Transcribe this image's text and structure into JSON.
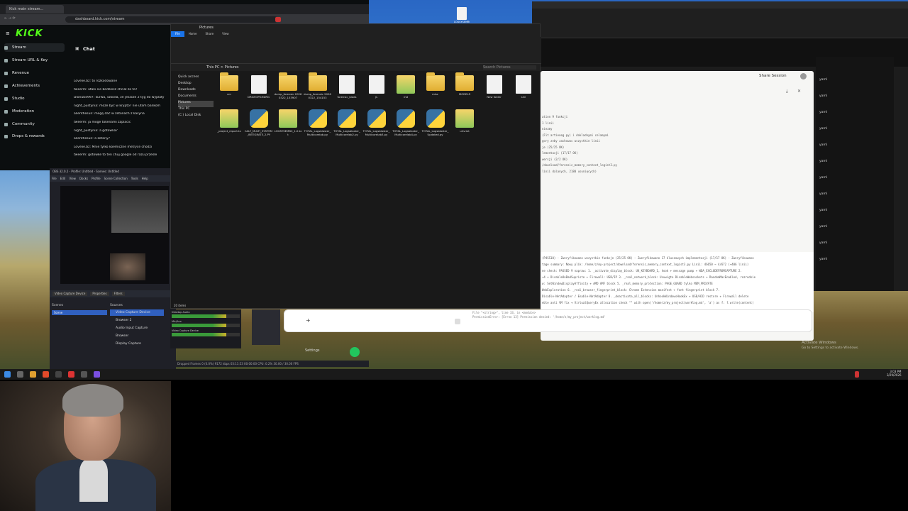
{
  "kick": {
    "tab_title": "Kick main stream...",
    "url": "dashboard.kick.com/stream",
    "logo": "KICK",
    "nav": [
      "Stream",
      "Stream URL & Key",
      "Revenue",
      "Achievements",
      "Studio",
      "Moderation",
      "Community",
      "Drops & rewards"
    ],
    "chat_title": "Chat",
    "messages": [
      "Lovelie.bz: to rozkodowane",
      "tweerm: ataki sie bedziesz chcial za to?",
      "Dionizos997: kurwa, szkoda, ze jeszcze 2 tyg do wyplaty",
      "night_pustynia: może być w krypto? nie ufam bankom",
      "alienthesun: mogę dać w żetonach z kasyna",
      "tweerm: ja moge tokenami zaplacic",
      "night_pustynia: a gotowka?",
      "alienthesun: a żetony?",
      "Lovelie.bz: Mnie tylko koemiczne metryce chodzi",
      "tweerm: gotowke to ten chuj google od razu przesle"
    ]
  },
  "obs": {
    "title": "OBS 32.0.2 - Profile: Untitled - Scenes: Untitled",
    "menu": [
      "File",
      "Edit",
      "View",
      "Docks",
      "Profile",
      "Scene Collection",
      "Tools",
      "Help"
    ],
    "toolbar": [
      "Video Capture Device",
      "Properties",
      "Filters"
    ],
    "scenes_title": "Scenes",
    "scene_selected": "Scene",
    "sources_title": "Sources",
    "sources": [
      "Video Capture Device",
      "Browser 2",
      "Audio Input Capture",
      "Browser",
      "Display Capture"
    ],
    "mixer": [
      "Desktop Audio",
      "Mic/Aux",
      "Video Capture Device"
    ],
    "settings_label": "Settings",
    "status": "Dropped Frames 0 (0.0%)    9172 kbps    03:11:53    00:00:00    CPU: 0.2%    30.00 / 30.00 FPS"
  },
  "explorer": {
    "title": "Pictures",
    "ribbon_tabs": [
      "File",
      "Home",
      "Share",
      "View"
    ],
    "path": "This PC > Pictures",
    "search_placeholder": "Search Pictures",
    "tree": [
      "Quick access",
      "Desktop",
      "Downloads",
      "Documents",
      "Pictures",
      "This PC",
      "(C:) Local Disk"
    ],
    "files_row1": [
      {
        "name": "cm",
        "kind": "folder"
      },
      {
        "name": "DRGHOPGHDRG",
        "kind": "doc"
      },
      {
        "name": "dump_forensic 20260322_153907",
        "kind": "folder"
      },
      {
        "name": "dump_forensic 20260322_154153",
        "kind": "folder"
      },
      {
        "name": "forensic_blads",
        "kind": "doc"
      },
      {
        "name": "js",
        "kind": "doc"
      },
      {
        "name": "md",
        "kind": "zip"
      },
      {
        "name": "misc",
        "kind": "folder"
      },
      {
        "name": "MODELS",
        "kind": "folder"
      },
      {
        "name": "New folder",
        "kind": "doc"
      },
      {
        "name": "sml",
        "kind": "doc"
      }
    ],
    "files_row2": [
      {
        "name": "_project_report.tx",
        "kind": "zip"
      },
      {
        "name": "CALY_MULTI_SYSTEM_INTEGRATE_2.PY",
        "kind": "py"
      },
      {
        "name": "LOGSYSEMBC_1.0.txt",
        "kind": "zip"
      },
      {
        "name": "TOTAL_Logsblaster_Multicorelab.py",
        "kind": "py"
      },
      {
        "name": "TOTAL_Logsblaster_Multicorelab2.py",
        "kind": "py"
      },
      {
        "name": "TOTAL_Logsblaster_Multicorelab3.py",
        "kind": "py"
      },
      {
        "name": "TOTAL_Logsblaster_Multicorelab4.py",
        "kind": "py"
      },
      {
        "name": "TOTAL_Logsblaster_Updated.py",
        "kind": "py"
      },
      {
        "name": "urls.txt",
        "kind": "zip"
      }
    ],
    "status": "20 items"
  },
  "session": {
    "share_label": "Share Session",
    "lines": [
      "ation   9 funkcji",
      "1 linii",
      "niezmy",
      "(Fit artieneg.py) i dokladnymi celamymi",
      "gory zeby zachowac wszystkie linii",
      "je (25/25 OK)",
      "lementacji (17/17 OK)",
      "wersji (2/2 OK)",
      "/download/forensic_memory_context_logist3.py",
      "linii dalanych, 2180 usunięcych)"
    ],
    "code_lines": [
      "(P4SS10) - Zweryfikowano wszystkie funkcje (25/25 OK) - Zweryfikowano 17 kluczowych implementacji (17/17 OK) - Zweryfikowano",
      "tage summary:    Nowy plik: /home/z/my-project/download/forensic_memory_context_logist3.py   Linii: 46650  → 4/672 (+406 linii)",
      "ne check: PASSED   9 napraw: 1. _activate_display_block: UK_KEYBOARD_1, hook + message pump + WDA_EXCLUDEFROMCAPTURE 2.",
      "+4 + DisableOnBadSupriste + Firewall: USB/IP 3. _real_network_block: Usuwigte DisableWebsockets + RandomMacEnabled, rozrodnie",
      "w: SetWindowDisplayAffinity + AMD AMF block 5. _real_memory_protection: PAGE_GUARD tylko MEM_PRIVATE",
      "WebExploration 6. _real_browser_fingerprint_block: Chrome Extension manifest + font fingerprint block 7.",
      "Disable-NetAdapter / Enable-NetAdapter 8. _deactivate_all_blocks: UnhookWindowsHookEx + USB/HID restore + Firewall delete",
      "eble anti VM fix + VirtualQueryEx allocation check   \"\" with open('/home/z/my_project/worklog.md', 'a') as f: f.write(content)"
    ],
    "error_lines": [
      "File \"<string>\", line 33, in <module>",
      "PermissionError: [Errno 13] Permission denied: '/home/z/my_project/worklog.md'"
    ],
    "input_plus": "+"
  },
  "right_list": [
    "yaml",
    "yaml",
    "yaml",
    "yaml",
    "yaml",
    "yaml",
    "yaml",
    "yaml",
    "yaml",
    "yaml",
    "yaml",
    "yaml"
  ],
  "desktop": {
    "icon_label": "LOGSYSEMBC",
    "activate_title": "Activate Windows",
    "activate_sub": "Go to Settings to activate Windows."
  },
  "clock": {
    "time": "3:03 PM",
    "date": "3/29/2026"
  },
  "colors": {
    "kick_green": "#53fc18",
    "obs_blue": "#3060c0",
    "folder": "#e1ae32"
  }
}
